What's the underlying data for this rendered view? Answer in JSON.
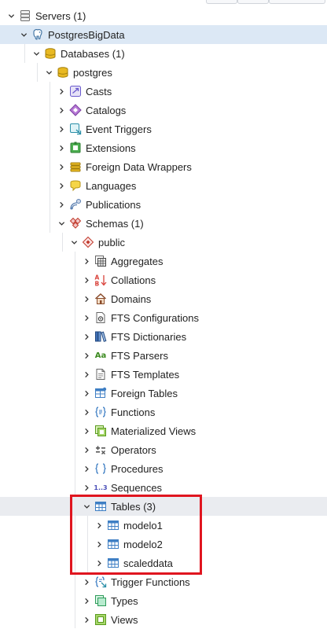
{
  "tree": {
    "servers": {
      "label": "Servers (1)",
      "icon": "servers-icon"
    },
    "server": {
      "label": "PostgresBigData",
      "icon": "postgres-elephant-icon"
    },
    "databases": {
      "label": "Databases (1)",
      "icon": "databases-icon"
    },
    "database": {
      "label": "postgres",
      "icon": "database-icon"
    },
    "db_items": [
      {
        "label": "Casts",
        "icon": "casts-icon"
      },
      {
        "label": "Catalogs",
        "icon": "catalogs-icon"
      },
      {
        "label": "Event Triggers",
        "icon": "event-triggers-icon"
      },
      {
        "label": "Extensions",
        "icon": "extensions-icon"
      },
      {
        "label": "Foreign Data Wrappers",
        "icon": "foreign-data-wrappers-icon"
      },
      {
        "label": "Languages",
        "icon": "languages-icon"
      },
      {
        "label": "Publications",
        "icon": "publications-icon"
      }
    ],
    "schemas": {
      "label": "Schemas (1)",
      "icon": "schemas-icon"
    },
    "schema": {
      "label": "public",
      "icon": "schema-icon"
    },
    "schema_items": [
      {
        "label": "Aggregates",
        "icon": "aggregates-icon"
      },
      {
        "label": "Collations",
        "icon": "collations-icon",
        "glyph_top": "A",
        "glyph_bottom": "B"
      },
      {
        "label": "Domains",
        "icon": "domains-icon"
      },
      {
        "label": "FTS Configurations",
        "icon": "fts-configurations-icon"
      },
      {
        "label": "FTS Dictionaries",
        "icon": "fts-dictionaries-icon"
      },
      {
        "label": "FTS Parsers",
        "icon": "fts-parsers-icon",
        "glyph": "Aa"
      },
      {
        "label": "FTS Templates",
        "icon": "fts-templates-icon"
      },
      {
        "label": "Foreign Tables",
        "icon": "foreign-tables-icon"
      },
      {
        "label": "Functions",
        "icon": "functions-icon"
      },
      {
        "label": "Materialized Views",
        "icon": "materialized-views-icon"
      },
      {
        "label": "Operators",
        "icon": "operators-icon"
      },
      {
        "label": "Procedures",
        "icon": "procedures-icon"
      },
      {
        "label": "Sequences",
        "icon": "sequences-icon",
        "glyph": "1..3"
      }
    ],
    "tables": {
      "label": "Tables (3)",
      "icon": "tables-icon"
    },
    "table_items": [
      {
        "label": "modelo1",
        "icon": "table-icon"
      },
      {
        "label": "modelo2",
        "icon": "table-icon"
      },
      {
        "label": "scaleddata",
        "icon": "table-icon"
      }
    ],
    "after_items": [
      {
        "label": "Trigger Functions",
        "icon": "trigger-functions-icon"
      },
      {
        "label": "Types",
        "icon": "types-icon"
      },
      {
        "label": "Views",
        "icon": "views-icon"
      }
    ]
  },
  "colors": {
    "selected_row": "#dce8f5",
    "hover_row": "#eaecf0",
    "highlight_box": "#e0151f"
  }
}
